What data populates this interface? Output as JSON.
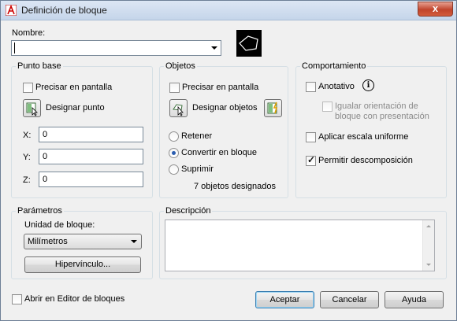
{
  "window": {
    "title": "Definición de bloque",
    "close_glyph": "x"
  },
  "name_section": {
    "label": "Nombre:",
    "value": ""
  },
  "base_point": {
    "title": "Punto base",
    "specify_on_screen": "Precisar en pantalla",
    "pick_point": "Designar punto",
    "x_label": "X:",
    "x_value": "0",
    "y_label": "Y:",
    "y_value": "0",
    "z_label": "Z:",
    "z_value": "0"
  },
  "objects": {
    "title": "Objetos",
    "specify_on_screen": "Precisar en pantalla",
    "select_objects": "Designar objetos",
    "retain": "Retener",
    "convert": "Convertir en bloque",
    "delete": "Suprimir",
    "count_text": "7 objetos designados",
    "selected_option": "convert"
  },
  "behavior": {
    "title": "Comportamiento",
    "annotative": "Anotativo",
    "info_glyph": "i",
    "match_orientation": "Igualar orientación de bloque con presentación",
    "scale_uniformly": "Aplicar escala uniforme",
    "allow_exploding": "Permitir descomposición",
    "annotative_checked": false,
    "scale_uniformly_checked": false,
    "allow_exploding_checked": true
  },
  "settings": {
    "title": "Parámetros",
    "block_unit_label": "Unidad de bloque:",
    "block_unit_value": "Milímetros",
    "hyperlink_button": "Hipervínculo..."
  },
  "description": {
    "title": "Descripción",
    "value": ""
  },
  "footer": {
    "open_in_editor": "Abrir en Editor de bloques",
    "ok": "Aceptar",
    "cancel": "Cancelar",
    "help": "Ayuda"
  },
  "colors": {
    "accent": "#2a5db0",
    "close_button": "#c0442c",
    "title_bar": "#c5d5ea"
  }
}
